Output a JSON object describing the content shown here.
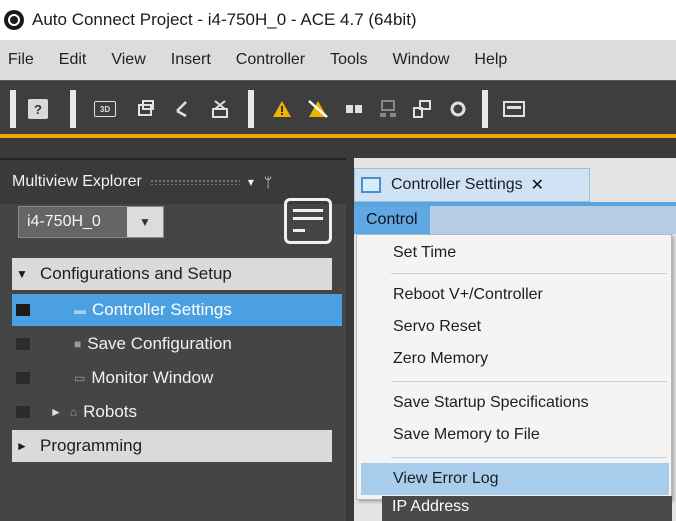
{
  "window": {
    "title": "Auto Connect Project - i4-750H_0 - ACE 4.7 (64bit)"
  },
  "menubar": {
    "items": [
      "File",
      "Edit",
      "View",
      "Insert",
      "Controller",
      "Tools",
      "Window",
      "Help"
    ]
  },
  "toolbar": {
    "help_label": "?",
    "btn_3d_label": "3D",
    "icons": [
      "help-icon",
      "3d-view-icon",
      "window-icon",
      "pointer-icon",
      "tool-icon",
      "warning-icon",
      "clear-warning-icon",
      "connect-icon",
      "network-icon",
      "device-icon",
      "refresh-icon"
    ]
  },
  "explorer": {
    "title": "Multiview Explorer",
    "dropdown_arrow": "▾",
    "pin": "ᛘ",
    "device": "i4-750H_0",
    "device_drop": "▼",
    "tree": {
      "config_group": "Configurations and Setup",
      "config_arrow": "▼",
      "controller_settings": "Controller Settings",
      "save_configuration": "Save Configuration",
      "monitor_window": "Monitor Window",
      "robots_arrow": "►",
      "robots": "Robots",
      "programming_group": "Programming",
      "programming_arrow": "►"
    }
  },
  "doc": {
    "tab_label": "Controller Settings",
    "tab_close": "✕",
    "control_menu": "Control",
    "menu_items": {
      "set_time": "Set Time",
      "reboot": "Reboot V+/Controller",
      "servo_reset": "Servo Reset",
      "zero_memory": "Zero Memory",
      "save_startup": "Save Startup Specifications",
      "save_memory": "Save Memory to File",
      "view_error_log": "View Error Log"
    },
    "ip_address": "IP Address"
  },
  "colors": {
    "accent": "#4aa0e0",
    "toolbar_strip": "#f0a800",
    "menu_hover": "#a9cdec"
  }
}
